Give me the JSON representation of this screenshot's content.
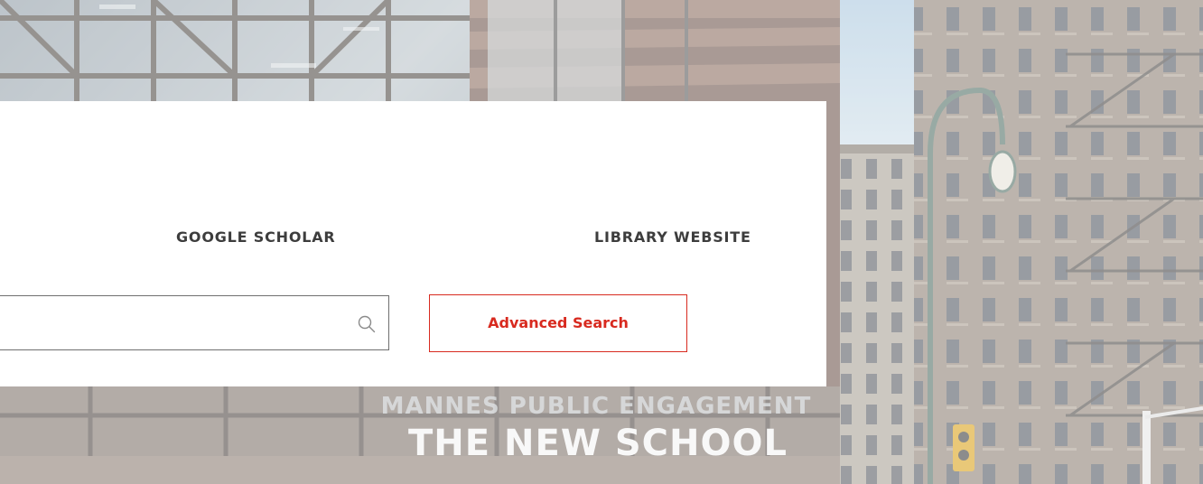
{
  "nav": {
    "google_scholar": "GOOGLE SCHOLAR",
    "library_website": "LIBRARY WEBSITE"
  },
  "search": {
    "value": "",
    "placeholder": "",
    "icon": "search-icon",
    "advanced_label": "Advanced Search"
  },
  "background": {
    "sign_text": "THE NEW SCHOOL",
    "upper_sign_text": "MANNES PUBLIC ENGAGEMENT"
  },
  "colors": {
    "accent": "#d82a1f",
    "nav_text": "#3d3d3d",
    "panel": "#ffffff",
    "input_border": "#6f6f6f"
  }
}
